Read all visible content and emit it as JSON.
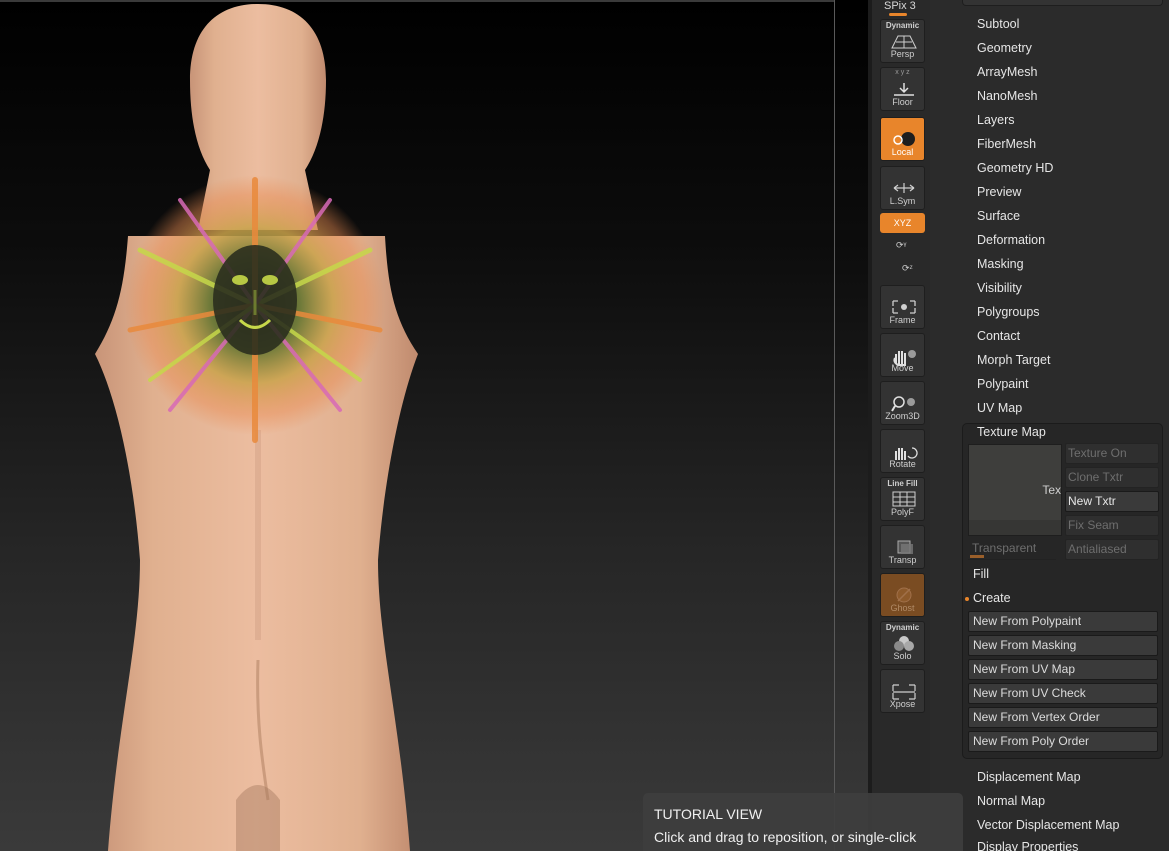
{
  "shelf": {
    "spix_label": "SPix 3",
    "buttons": {
      "persp": {
        "top": "Dynamic",
        "label": "Persp"
      },
      "floor": {
        "label": "Floor"
      },
      "local": {
        "label": "Local"
      },
      "lsym": {
        "label": "L.Sym"
      },
      "xyz": {
        "label": "XYZ"
      },
      "frame": {
        "label": "Frame"
      },
      "move": {
        "label": "Move"
      },
      "zoom3d": {
        "label": "Zoom3D"
      },
      "rotate": {
        "label": "Rotate"
      },
      "polyf": {
        "top": "Line Fill",
        "label": "PolyF"
      },
      "transp": {
        "label": "Transp"
      },
      "ghost": {
        "label": "Ghost"
      },
      "solo": {
        "top": "Dynamic",
        "label": "Solo"
      },
      "xpose": {
        "label": "Xpose"
      }
    },
    "floor_axes": "x y z"
  },
  "panel": {
    "menu_items": [
      "Subtool",
      "Geometry",
      "ArrayMesh",
      "NanoMesh",
      "Layers",
      "FiberMesh",
      "Geometry HD",
      "Preview",
      "Surface",
      "Deformation",
      "Masking",
      "Visibility",
      "Polygroups",
      "Contact",
      "Morph Target",
      "Polypaint",
      "UV Map"
    ],
    "texture_map": {
      "title": "Texture Map",
      "thumb_label": "Tex",
      "buttons": [
        "Texture On",
        "Clone Txtr",
        "New Txtr",
        "Fix Seam",
        "Antialiased"
      ],
      "transparent": "Transparent",
      "fill": "Fill",
      "create": "Create",
      "create_buttons": [
        "New From Polypaint",
        "New From Masking",
        "New From UV Map",
        "New From UV Check",
        "New From Vertex Order",
        "New From Poly Order"
      ]
    },
    "bottom_items": [
      "Displacement Map",
      "Normal Map",
      "Vector Displacement Map",
      "Display Properties"
    ]
  },
  "tutorial": {
    "title": "TUTORIAL VIEW",
    "body": "Click and drag to reposition, or single-click"
  },
  "colors": {
    "accent": "#e8852b",
    "panel_bg": "#2b2b2b",
    "skin": "#e6b89c"
  }
}
